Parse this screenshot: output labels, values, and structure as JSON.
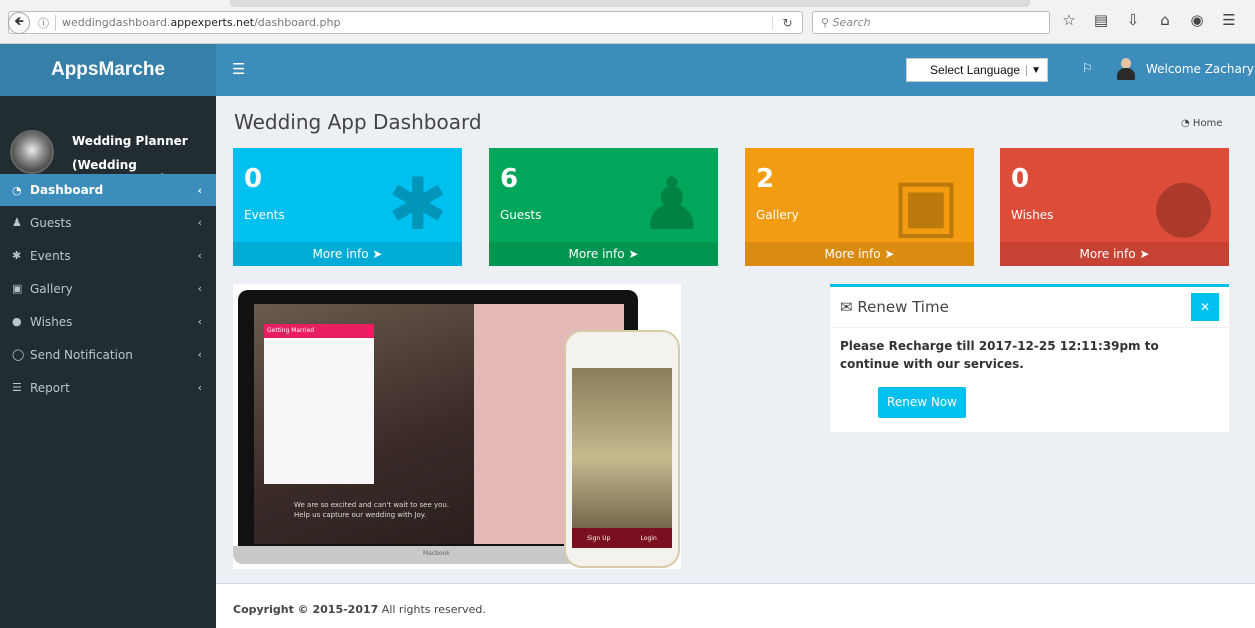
{
  "browser": {
    "url_prefix": "weddingdashboard.",
    "url_domain": "appexperts.net",
    "url_path": "/dashboard.php",
    "search_placeholder": "Search"
  },
  "header": {
    "logo": "AppsMarche",
    "language_select": "Select Language",
    "welcome": "Welcome Zachary"
  },
  "sidebar": {
    "user_name": "Wedding Planner",
    "user_role": "(Wedding Management)",
    "items": [
      {
        "label": "Dashboard",
        "icon": "dashboard-icon"
      },
      {
        "label": "Guests",
        "icon": "user-icon"
      },
      {
        "label": "Events",
        "icon": "asterisk-icon"
      },
      {
        "label": "Gallery",
        "icon": "image-icon"
      },
      {
        "label": "Wishes",
        "icon": "comment-icon"
      },
      {
        "label": "Send Notification",
        "icon": "chat-bubble-icon"
      },
      {
        "label": "Report",
        "icon": "list-icon"
      }
    ]
  },
  "main": {
    "title": "Wedding App Dashboard",
    "breadcrumb": "Home",
    "boxes": [
      {
        "count": "0",
        "label": "Events",
        "more": "More info",
        "color": "#00c0ef"
      },
      {
        "count": "6",
        "label": "Guests",
        "more": "More info",
        "color": "#00a65a"
      },
      {
        "count": "2",
        "label": "Gallery",
        "more": "More info",
        "color": "#f39c12"
      },
      {
        "count": "0",
        "label": "Wishes",
        "more": "More info",
        "color": "#dd4b39"
      }
    ],
    "promo": {
      "app_bar": "Getting Married",
      "quote_line1": "We are so excited and can't wait to see you.",
      "quote_line2": "Help us capture our wedding with Joy.",
      "laptop_label": "Macbook",
      "phone_signup": "Sign Up",
      "phone_login": "Login"
    },
    "renew": {
      "title": "Renew Time",
      "message": "Please Recharge till 2017-12-25 12:11:39pm to continue with our services.",
      "button": "Renew Now"
    }
  },
  "footer": {
    "copyright": "Copyright © 2015-2017",
    "rights": " All rights reserved."
  }
}
